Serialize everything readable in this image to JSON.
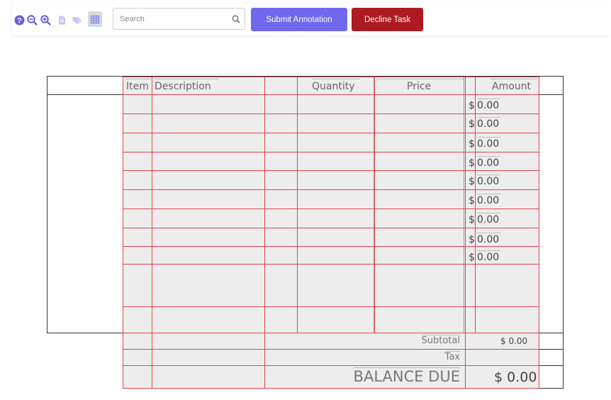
{
  "toolbar": {
    "icons": [
      "help-icon",
      "zoom-out-icon",
      "zoom-in-icon",
      "document-icon",
      "tag-icon",
      "table-icon"
    ],
    "search": {
      "placeholder": "Search",
      "value": ""
    },
    "submit_label": "Submit Annotation",
    "decline_label": "Decline Task",
    "colors": {
      "submit": "#7068ec",
      "decline": "#ad1a22",
      "icon": "#6b5fe0",
      "annotation": "#e0454c"
    }
  },
  "invoice": {
    "columns": [
      "Item",
      "Description",
      "Quantity",
      "Price",
      "Amount"
    ],
    "line_amounts": [
      {
        "currency": "$",
        "value": "0.00"
      },
      {
        "currency": "$",
        "value": "0.00"
      },
      {
        "currency": "$",
        "value": "0.00"
      },
      {
        "currency": "$",
        "value": "0.00"
      },
      {
        "currency": "$",
        "value": "0.00"
      },
      {
        "currency": "$",
        "value": "0.00"
      },
      {
        "currency": "$",
        "value": "0.00"
      },
      {
        "currency": "$",
        "value": "0.00"
      },
      {
        "currency": "$",
        "value": "0.00"
      }
    ],
    "subtotal": {
      "label": "Subtotal",
      "value": "$ 0.00"
    },
    "tax": {
      "label": "Tax",
      "value": ""
    },
    "balance_due": {
      "label": "BALANCE DUE",
      "value": "$ 0.00"
    }
  }
}
